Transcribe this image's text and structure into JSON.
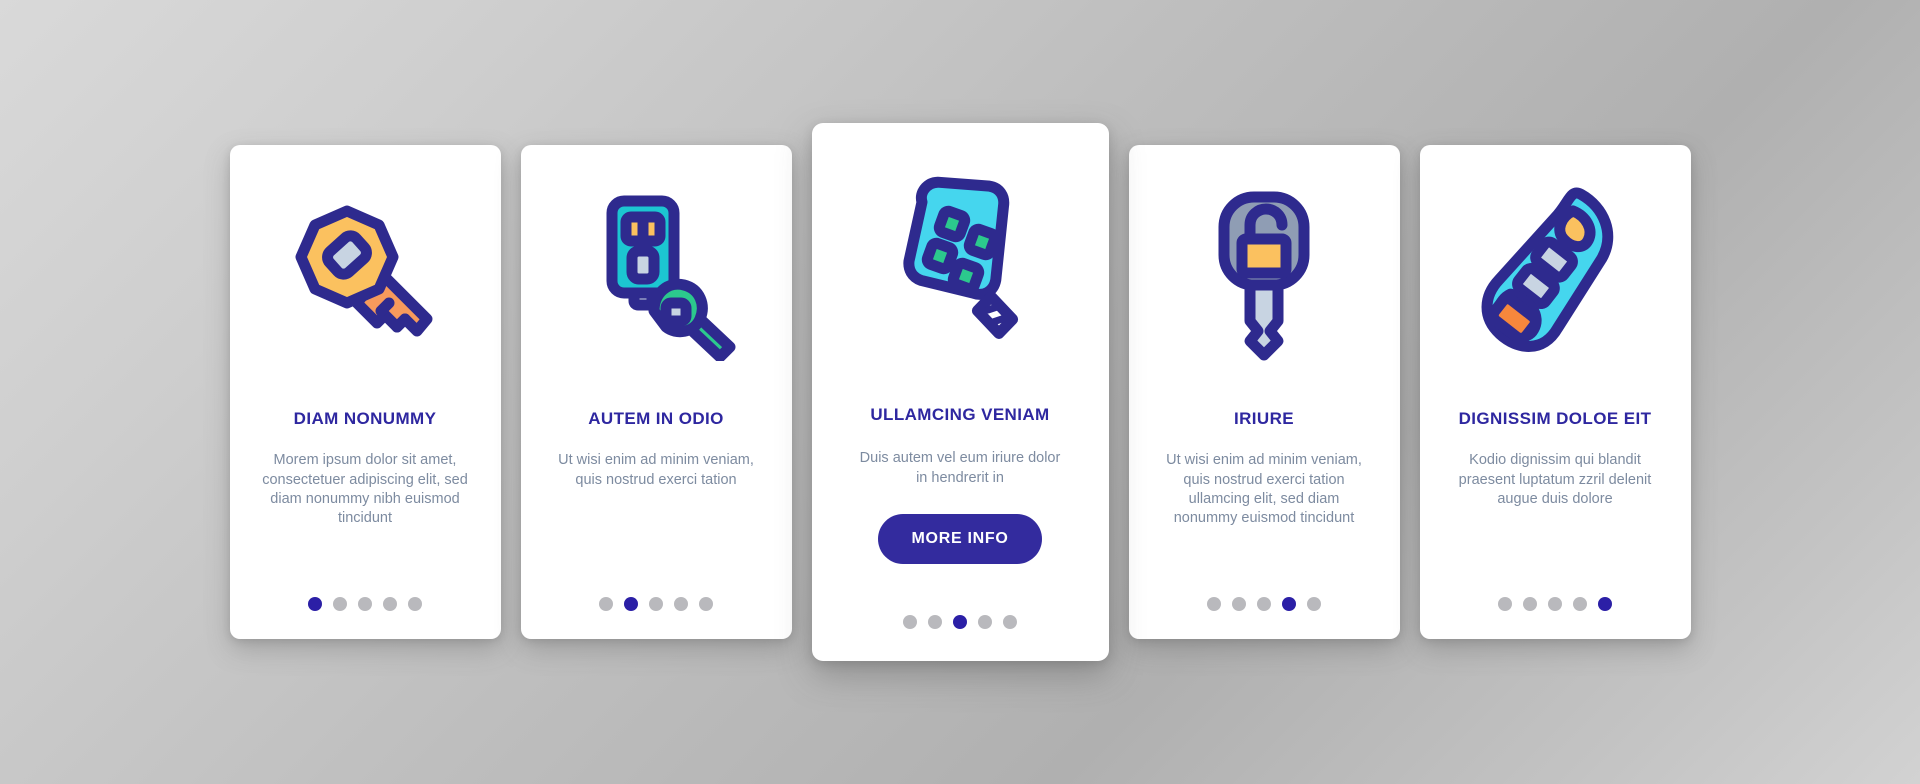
{
  "theme": {
    "accent_indigo": "#2e27a0",
    "button_indigo": "#332b9e",
    "body_text_gray": "#7d8ba0",
    "dot_inactive": "#b9b9bd",
    "dot_active": "#2b1fa6",
    "card_background": "#ffffff",
    "page_background": "#c4c4c4",
    "icon_outline": "#2e2a8e",
    "icon_yellow": "#fbc15f",
    "icon_orange": "#f79a5c",
    "icon_cyan": "#45d6ee",
    "icon_teal": "#1cc6d1",
    "icon_green": "#2cc98d",
    "icon_gray_blue": "#8f9db4",
    "icon_light_gray": "#c8d4e2"
  },
  "cards": [
    {
      "icon": "classic-key-icon",
      "title": "DIAM NONUMMY",
      "body": "Morem ipsum dolor sit amet, consectetuer adipiscing elit, sed diam nonummy nibh euismod tincidunt",
      "dots_total": 5,
      "dot_active_index": 1,
      "featured": false
    },
    {
      "icon": "key-fob-with-key-icon",
      "title": "AUTEM IN ODIO",
      "body": "Ut wisi enim ad minim veniam, quis nostrud exerci tation",
      "dots_total": 5,
      "dot_active_index": 2,
      "featured": false
    },
    {
      "icon": "usb-car-remote-icon",
      "title": "ULLAMCING VENIAM",
      "body": "Duis autem vel eum iriure dolor in hendrerit in",
      "button_label": "MORE INFO",
      "dots_total": 5,
      "dot_active_index": 3,
      "featured": true
    },
    {
      "icon": "key-with-open-padlock-icon",
      "title": "IRIURE",
      "body": "Ut wisi enim ad minim veniam, quis nostrud exerci tation ullamcing elit, sed diam nonummy euismod tincidunt",
      "dots_total": 5,
      "dot_active_index": 4,
      "featured": false
    },
    {
      "icon": "car-key-remote-icon",
      "title": "DIGNISSIM DOLOE EIT",
      "body": "Kodio dignissim qui blandit praesent luptatum zzril delenit augue duis dolore",
      "dots_total": 5,
      "dot_active_index": 5,
      "featured": false
    }
  ]
}
